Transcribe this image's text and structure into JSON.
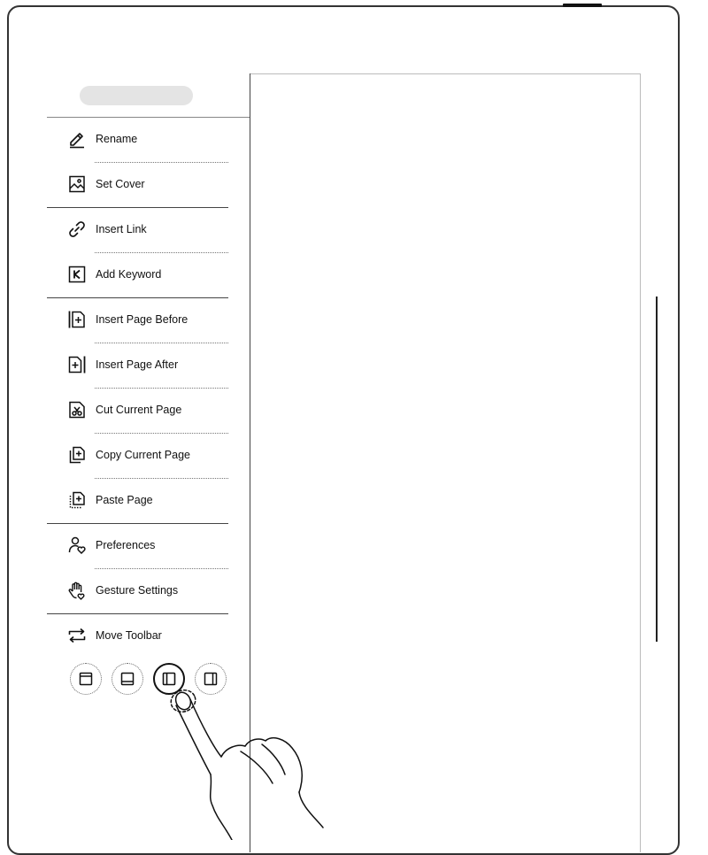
{
  "device": {
    "frame_color": "#333333"
  },
  "panel": {
    "menu_items": [
      {
        "label": "Rename",
        "icon": "pencil-icon"
      },
      {
        "label": "Set Cover",
        "icon": "image-frame-icon"
      },
      {
        "label": "Insert Link",
        "icon": "link-icon"
      },
      {
        "label": "Add Keyword",
        "icon": "keyword-k-icon"
      },
      {
        "label": "Insert Page Before",
        "icon": "insert-page-before-icon"
      },
      {
        "label": "Insert Page After",
        "icon": "insert-page-after-icon"
      },
      {
        "label": "Cut Current Page",
        "icon": "scissors-page-icon"
      },
      {
        "label": "Copy Current Page",
        "icon": "copy-page-icon"
      },
      {
        "label": "Paste Page",
        "icon": "paste-page-icon"
      },
      {
        "label": "Preferences",
        "icon": "user-heart-icon"
      },
      {
        "label": "Gesture Settings",
        "icon": "hand-gesture-icon"
      },
      {
        "label": "Move Toolbar",
        "icon": "swap-arrows-icon"
      }
    ],
    "toolbar_positions": [
      {
        "name": "top",
        "icon": "toolbar-top-icon",
        "selected": false
      },
      {
        "name": "bottom",
        "icon": "toolbar-bottom-icon",
        "selected": false
      },
      {
        "name": "left",
        "icon": "toolbar-left-icon",
        "selected": true
      },
      {
        "name": "right",
        "icon": "toolbar-right-icon",
        "selected": false
      }
    ]
  }
}
